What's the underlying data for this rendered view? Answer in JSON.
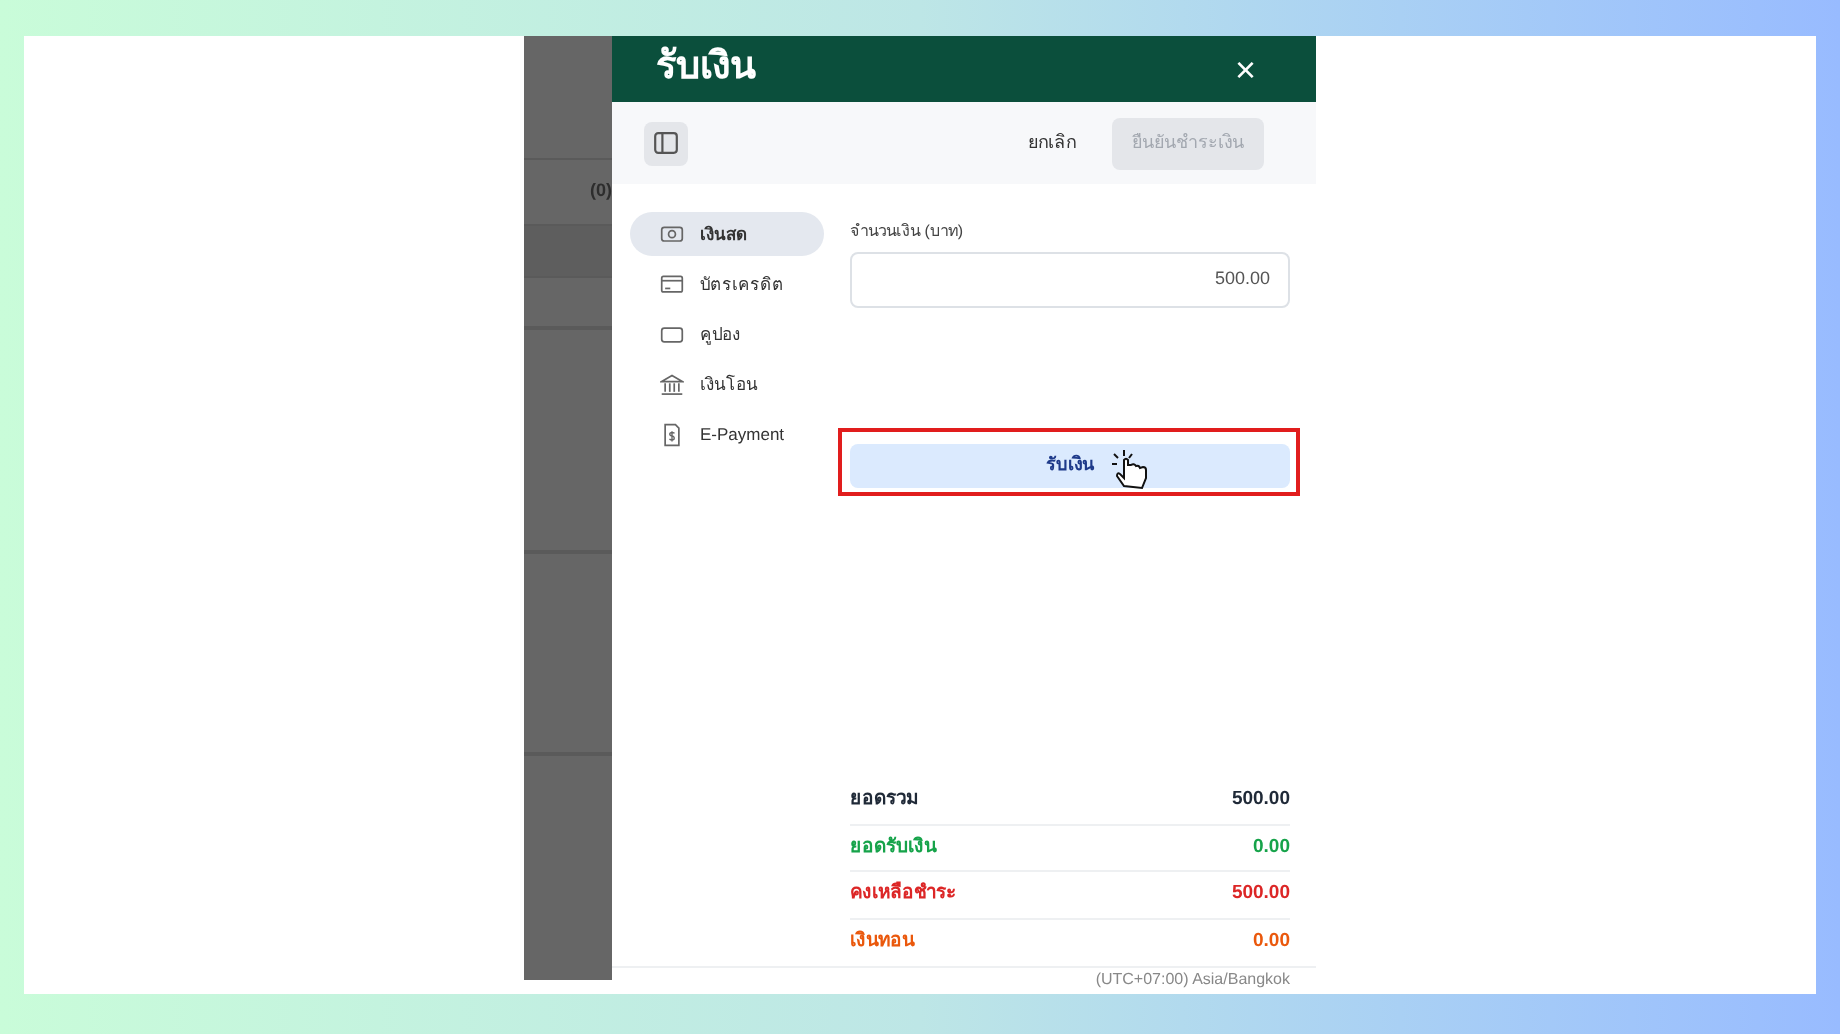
{
  "background_page": {
    "visible_text": "(0)"
  },
  "dialog": {
    "title": "รับเงิน",
    "close": "×",
    "toolbar": {
      "cancel": "ยกเลิก",
      "confirm": {
        "label": "ยืนยันชำระเงิน",
        "disabled": true
      }
    },
    "payment_methods": [
      {
        "kind": "cash",
        "label": "เงินสด",
        "selected": true
      },
      {
        "kind": "card",
        "label": "บัตรเครดิต",
        "selected": false
      },
      {
        "kind": "coupon",
        "label": "คูปอง",
        "selected": false
      },
      {
        "kind": "bank",
        "label": "เงินโอน",
        "selected": false
      },
      {
        "kind": "epayment",
        "label": "E-Payment",
        "selected": false
      }
    ],
    "amount_field": {
      "label": "จำนวนเงิน (บาท)",
      "value": "500.00"
    },
    "receive_button": {
      "label": "รับเงิน",
      "highlighted": true
    },
    "summary": [
      {
        "label": "ยอดรวม",
        "value": "500.00",
        "color": "#1f2937"
      },
      {
        "label": "ยอดรับเงิน",
        "value": "0.00",
        "color": "#16a34a"
      },
      {
        "label": "คงเหลือชำระ",
        "value": "500.00",
        "color": "#dc2626"
      },
      {
        "label": "เงินทอน",
        "value": "0.00",
        "color": "#ea580c"
      }
    ],
    "timezone": "(UTC+07:00) Asia/Bangkok"
  }
}
